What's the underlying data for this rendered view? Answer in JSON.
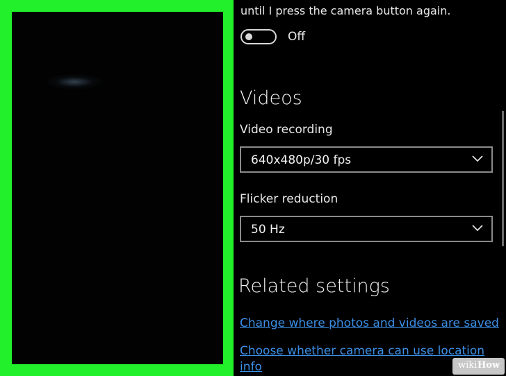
{
  "camera_preview": {},
  "settings": {
    "photo_description": "until I press the camera button again.",
    "photo_toggle_state": "Off",
    "videos_heading": "Videos",
    "video_recording_label": "Video recording",
    "video_recording_value": "640x480p/30 fps",
    "flicker_label": "Flicker reduction",
    "flicker_value": "50 Hz",
    "related_heading": "Related settings",
    "link_storage": "Change where photos and videos are saved",
    "link_location_line1": "Choose whether camera can use location",
    "link_location_line2": "info"
  },
  "watermark": {
    "part1": "wiki",
    "part2": "How"
  }
}
